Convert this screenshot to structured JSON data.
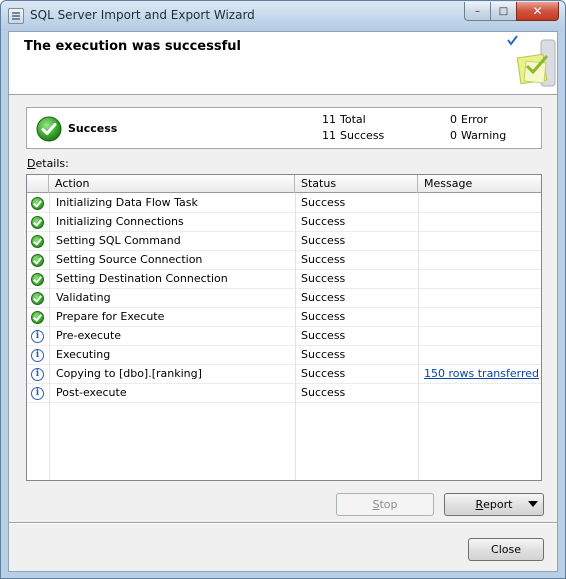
{
  "window": {
    "title": "SQL Server Import and Export Wizard",
    "minimize_glyph": "–",
    "maximize_glyph": "□",
    "close_glyph": "✕"
  },
  "header": {
    "title": "The execution was successful",
    "art_icon": "wizard-success-art"
  },
  "summary": {
    "status": "Success",
    "total_count": "11",
    "total_label": "Total",
    "success_count": "11",
    "success_label": "Success",
    "error_count": "0",
    "error_label": "Error",
    "warning_count": "0",
    "warning_label": "Warning"
  },
  "details": {
    "label_accel": "D",
    "label_rest": "etails:",
    "columns": [
      "Action",
      "Status",
      "Message"
    ],
    "rows": [
      {
        "icon": "success",
        "action": "Initializing Data Flow Task",
        "status": "Success",
        "message": ""
      },
      {
        "icon": "success",
        "action": "Initializing Connections",
        "status": "Success",
        "message": ""
      },
      {
        "icon": "success",
        "action": "Setting SQL Command",
        "status": "Success",
        "message": ""
      },
      {
        "icon": "success",
        "action": "Setting Source Connection",
        "status": "Success",
        "message": ""
      },
      {
        "icon": "success",
        "action": "Setting Destination Connection",
        "status": "Success",
        "message": ""
      },
      {
        "icon": "success",
        "action": "Validating",
        "status": "Success",
        "message": ""
      },
      {
        "icon": "success",
        "action": "Prepare for Execute",
        "status": "Success",
        "message": ""
      },
      {
        "icon": "info",
        "action": "Pre-execute",
        "status": "Success",
        "message": ""
      },
      {
        "icon": "info",
        "action": "Executing",
        "status": "Success",
        "message": ""
      },
      {
        "icon": "info",
        "action": "Copying to [dbo].[ranking]",
        "status": "Success",
        "message": "150 rows transferred"
      },
      {
        "icon": "info",
        "action": "Post-execute",
        "status": "Success",
        "message": ""
      }
    ]
  },
  "buttons": {
    "stop_accel": "S",
    "stop_rest": "top",
    "report_accel": "R",
    "report_rest": "eport",
    "close": "Close"
  },
  "info_glyph": "i"
}
